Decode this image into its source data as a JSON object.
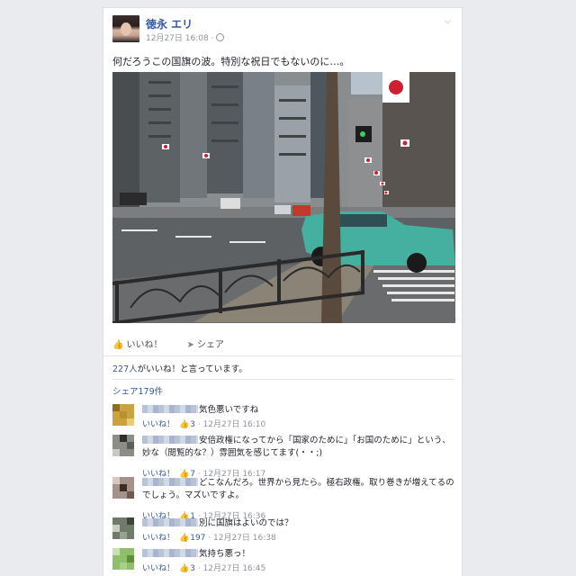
{
  "post": {
    "author": "徳永 エリ",
    "date": "12月27日 16:08",
    "text": "何だろうこの国旗の波。特別な祝日でもないのに…。"
  },
  "actions": {
    "like": "いいね！",
    "share": "シェア"
  },
  "likes_summary": {
    "count_text": "227人",
    "rest": "がいいね！と言っています。"
  },
  "shares_text": "シェア179件",
  "comments": [
    {
      "text": "気色悪いですね",
      "like_label": "いいね！",
      "likes": "3",
      "time": "12月27日 16:10"
    },
    {
      "text": "安倍政権になってから「国家のために」「お国のために」という、妙な（閲覧的な？）雰囲気を感じてます(・・;)",
      "like_label": "いいね！",
      "likes": "7",
      "time": "12月27日 16:17"
    },
    {
      "text": "どこなんだろ。世界から見たら。極右政権。取り巻きが増えてるのでしょう。マズいですよ。",
      "like_label": "いいね！",
      "likes": "1",
      "time": "12月27日 16:36"
    },
    {
      "text": "別に国旗はよいのでは？",
      "like_label": "いいね！",
      "likes": "197",
      "time": "12月27日 16:38"
    },
    {
      "text": "気持ち悪っ！",
      "like_label": "いいね！",
      "likes": "3",
      "time": "12月27日 16:45"
    }
  ],
  "icons": [
    "chevron-down-icon",
    "globe-icon",
    "thumbs-up-icon",
    "share-arrow-icon"
  ],
  "colors": {
    "link": "#365899",
    "meta": "#90949c",
    "like_blue": "#5890ff"
  }
}
